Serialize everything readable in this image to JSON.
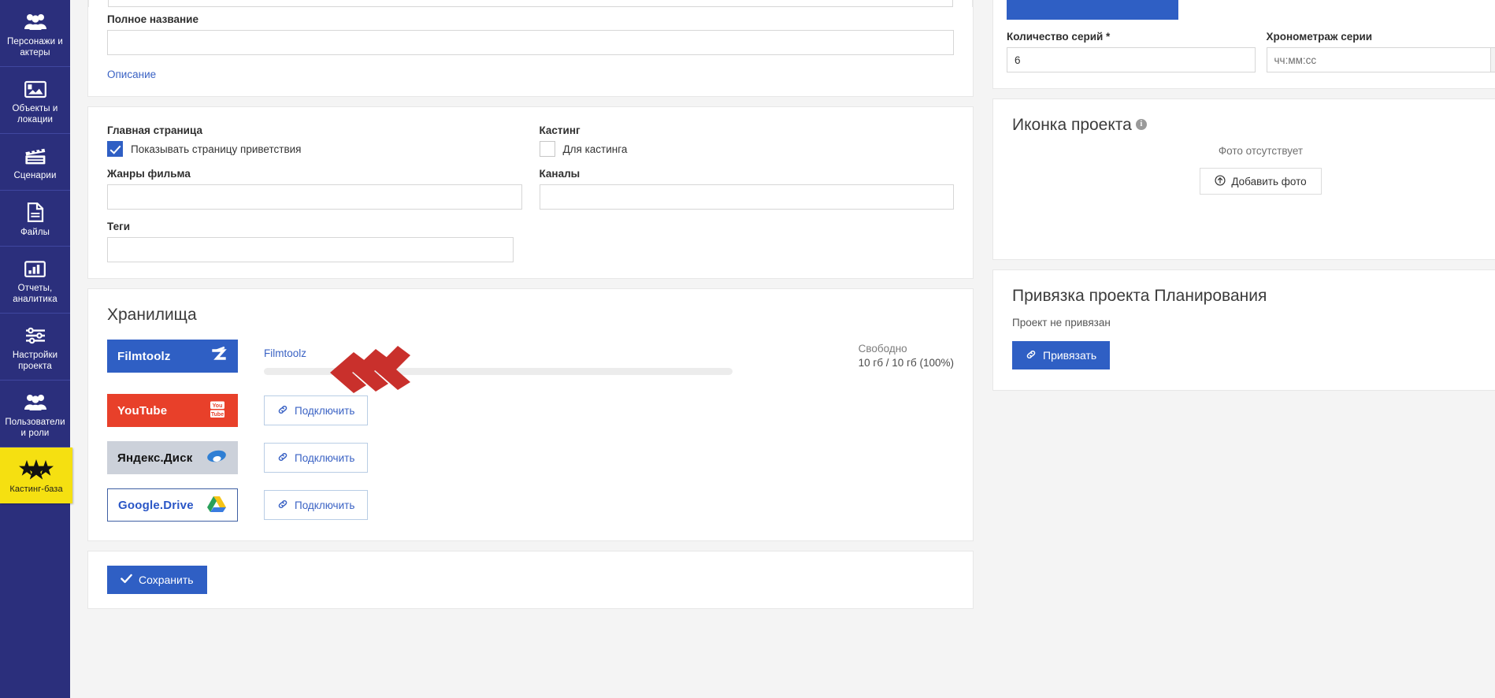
{
  "sidebar": {
    "items": [
      {
        "label": "Персонажи и актеры",
        "icon": "people-icon",
        "highlight": false
      },
      {
        "label": "Объекты и локации",
        "icon": "image-icon",
        "highlight": false
      },
      {
        "label": "Сценарии",
        "icon": "clapperboard-icon",
        "highlight": false
      },
      {
        "label": "Файлы",
        "icon": "document-icon",
        "highlight": false
      },
      {
        "label": "Отчеты, аналитика",
        "icon": "bar-chart-icon",
        "highlight": false
      },
      {
        "label": "Настройки проекта",
        "icon": "sliders-icon",
        "highlight": false
      },
      {
        "label": "Пользователи и роли",
        "icon": "users-icon",
        "highlight": false
      },
      {
        "label": "Кастинг-база",
        "icon": "stars-icon",
        "highlight": true
      }
    ]
  },
  "form": {
    "full_title_label": "Полное название",
    "full_title_value": "",
    "description_link": "Описание"
  },
  "settings": {
    "home_page_label": "Главная страница",
    "show_welcome_label": "Показывать страницу приветствия",
    "show_welcome_checked": true,
    "casting_label": "Кастинг",
    "for_casting_label": "Для кастинга",
    "for_casting_checked": false,
    "genres_label": "Жанры фильма",
    "genres_value": "",
    "channels_label": "Каналы",
    "channels_value": "",
    "tags_label": "Теги",
    "tags_value": ""
  },
  "episodes": {
    "count_label": "Количество серий",
    "count_required": true,
    "count_value": "6",
    "duration_label": "Хронометраж серии",
    "duration_placeholder": "чч:мм:сс",
    "clock_icon": "clock-icon"
  },
  "storages": {
    "title": "Хранилища",
    "connect_label": "Подключить",
    "link_icon": "link-icon",
    "items": [
      {
        "name": "Filmtoolz",
        "logo_text": "Filmtoolz",
        "style": "filmtoolz",
        "connected": true,
        "display_name": "Filmtoolz",
        "quota_label": "Свободно",
        "quota_value": "10 гб / 10 гб (100%)",
        "progress_percent": 100
      },
      {
        "name": "YouTube",
        "logo_text": "YouTube",
        "style": "youtube",
        "connected": false
      },
      {
        "name": "Яндекс.Диск",
        "logo_text": "Яндекс.Диск",
        "style": "yandex",
        "connected": false
      },
      {
        "name": "Google.Drive",
        "logo_text": "Google.Drive",
        "style": "gdrive",
        "connected": false
      }
    ]
  },
  "project_icon": {
    "title": "Иконка проекта",
    "info_icon": "info-icon",
    "no_photo_text": "Фото отсутствует",
    "add_photo_label": "Добавить фото",
    "upload_icon": "upload-circle-icon"
  },
  "planning": {
    "title": "Привязка проекта Планирования",
    "status_text": "Проект не привязан",
    "bind_label": "Привязать",
    "link_icon": "link-icon"
  },
  "footer": {
    "save_label": "Сохранить",
    "check_icon": "check-icon"
  },
  "annotation": {
    "arrow_color": "#c9302c",
    "arrow_count": 3,
    "points_to": "Filmtoolz"
  },
  "colors": {
    "sidebar_bg": "#2b2f7c",
    "highlight_bg": "#f5e011",
    "primary": "#2f5fc4",
    "youtube": "#e8402a",
    "page_bg": "#f4f4f4"
  }
}
